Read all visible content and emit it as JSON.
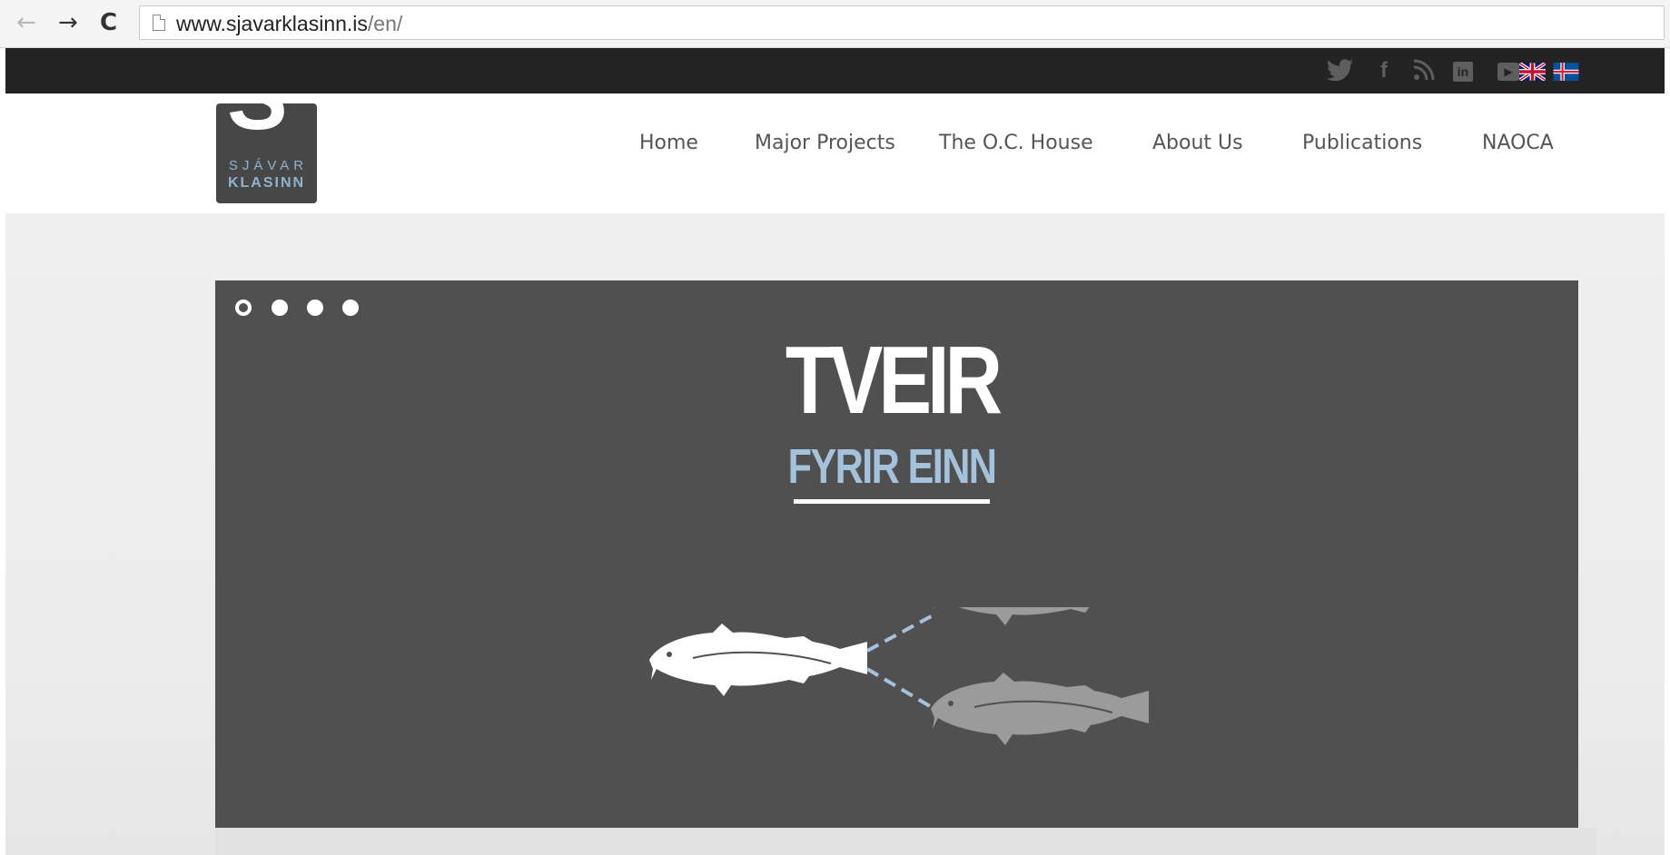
{
  "browser": {
    "back_icon": "←",
    "forward_icon": "→",
    "reload_icon": "C",
    "url_host": "www.sjavarklasinn.is",
    "url_path": "/en/"
  },
  "topbar": {
    "social_icons": [
      "twitter-icon",
      "facebook-icon",
      "rss-icon",
      "linkedin-icon",
      "youtube-icon"
    ],
    "twitter_glyph": "🐦",
    "facebook_glyph": "f",
    "rss_glyph": "⊃",
    "linkedin_glyph": "in",
    "youtube_glyph": "▶",
    "languages": [
      "english-flag",
      "icelandic-flag"
    ]
  },
  "logo": {
    "line1": "SJÁVAR",
    "line2": "KLASINN",
    "mark": "S"
  },
  "nav": {
    "home": "Home",
    "major_projects": "Major Projects",
    "oc_house": "The O.C. House",
    "about_us": "About Us",
    "publications": "Publications",
    "naoca": "NAOCA"
  },
  "slider": {
    "slide_count": 4,
    "active_slide": 1,
    "title": "TVEIR",
    "subtitle": "FYRIR EINN"
  },
  "colors": {
    "topbar": "#232323",
    "slide_background": "#505050",
    "accent_blue": "#a4c2dc",
    "logo_background": "#474748"
  }
}
